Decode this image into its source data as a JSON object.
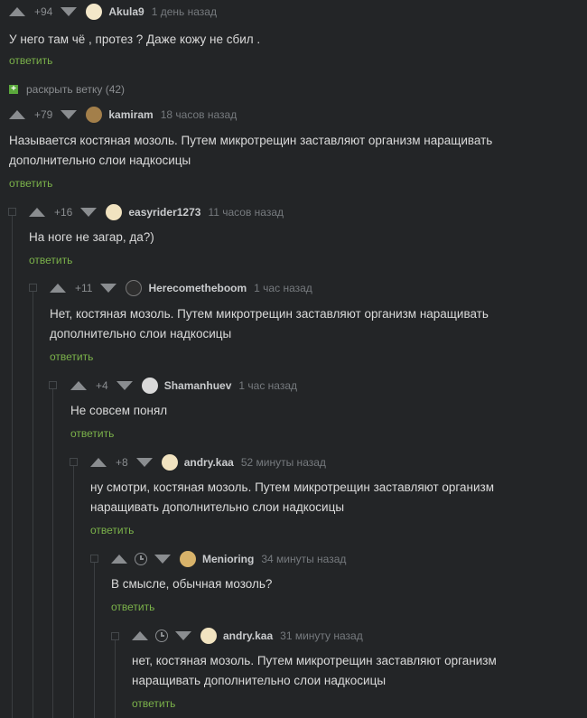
{
  "ui": {
    "reply_label": "ответить",
    "expand_label": "раскрыть ветку (42)"
  },
  "colors": {
    "background": "#232527",
    "reply_link": "#7bb24a",
    "meta": "#8a8d90"
  },
  "comments": [
    {
      "rating": "+94",
      "author": "Akula9",
      "time": "1 день назад",
      "lines": [
        "У него там чё , протез ? Даже кожу не сбил ."
      ],
      "avatar_color": "#f3e7c9"
    },
    {
      "rating": "+79",
      "author": "kamiram",
      "time": "18 часов назад",
      "lines": [
        "Называется костяная мозоль. Путем микротрещин заставляют организм наращивать",
        "дополнительно слои надкосицы"
      ],
      "avatar_color": "#a37f4a"
    },
    {
      "rating": "+16",
      "author": "easyrider1273",
      "time": "11 часов назад",
      "lines": [
        "На ноге не загар, да?)"
      ],
      "avatar_color": "#f1e3c0"
    },
    {
      "rating": "+11",
      "author": "Herecometheboom",
      "time": "1 час назад",
      "lines": [
        "Нет, костяная мозоль. Путем микротрещин заставляют организм наращивать",
        "дополнительно слои надкосицы"
      ],
      "avatar_color": "#2e2e2e"
    },
    {
      "rating": "+4",
      "author": "Shamanhuev",
      "time": "1 час назад",
      "lines": [
        "Не совсем понял"
      ],
      "avatar_color": "#d9d9d9"
    },
    {
      "rating": "+8",
      "author": "andry.kaa",
      "time": "52 минуты назад",
      "lines": [
        "ну смотри, костяная мозоль. Путем микротрещин заставляют организм",
        "наращивать дополнительно слои надкосицы"
      ],
      "avatar_color": "#f1e3c0"
    },
    {
      "rating": "",
      "author": "Menioring",
      "time": "34 минуты назад",
      "lines": [
        "В смысле, обычная мозоль?"
      ],
      "avatar_color": "#d8b36a"
    },
    {
      "rating": "",
      "author": "andry.kaa",
      "time": "31 минуту назад",
      "lines": [
        "нет, костяная мозоль. Путем микротрещин заставляют организм",
        "наращивать дополнительно слои надкосицы"
      ],
      "avatar_color": "#f1e3c0"
    }
  ]
}
